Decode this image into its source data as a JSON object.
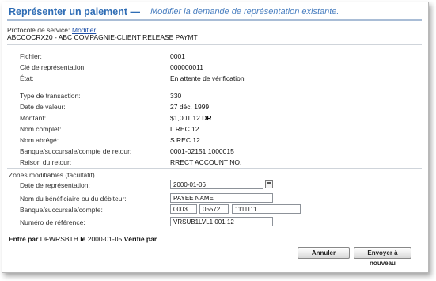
{
  "header": {
    "title": "Représenter un paiement —",
    "subtitle": "Modifier la demande de représentation existante."
  },
  "protocol": {
    "label": "Protocole de service:",
    "link": "Modifier",
    "value": "ABCCOCRX20 - ABC COMPAGNIE-CLIENT RELEASE PAYMT"
  },
  "section1": [
    {
      "label": "Fichier:",
      "value": "0001"
    },
    {
      "label": "Clé de représentation:",
      "value": "000000011"
    },
    {
      "label": "État:",
      "value": "En attente de vérification"
    }
  ],
  "section2": [
    {
      "label": "Type de transaction:",
      "value": "330"
    },
    {
      "label": "Date de valeur:",
      "value": "27 déc. 1999"
    },
    {
      "label": "Montant:",
      "value": "$1,001.12",
      "suffix": "DR"
    },
    {
      "label": "Nom complet:",
      "value": "L REC 12"
    },
    {
      "label": "Nom abrégé:",
      "value": "S REC 12"
    },
    {
      "label": "Banque/succursale/compte de retour:",
      "value": "0001-02151 1000015"
    },
    {
      "label": "Raison du retour:",
      "value": "RRECT ACCOUNT NO."
    }
  ],
  "editable": {
    "title": "Zones modifiables (facultatif)",
    "date_label": "Date de représentation:",
    "date_value": "2000-01-06",
    "payee_label": "Nom du bénéficiaire ou du débiteur:",
    "payee_value": "PAYEE NAME",
    "bank_label": "Banque/succursale/compte:",
    "bank_value": "0003",
    "branch_value": "05572",
    "account_value": "1111111",
    "ref_label": "Numéro de référence:",
    "ref_value": "VRSUB1LVL1 001 12"
  },
  "footer": {
    "entered_by_label": "Entré par",
    "entered_by": "DFWRSBTH",
    "on_label": "le",
    "date": "2000-01-05",
    "verified_label": "Vérifié par"
  },
  "buttons": {
    "cancel": "Annuler",
    "send": "Envoyer à nouveau"
  }
}
